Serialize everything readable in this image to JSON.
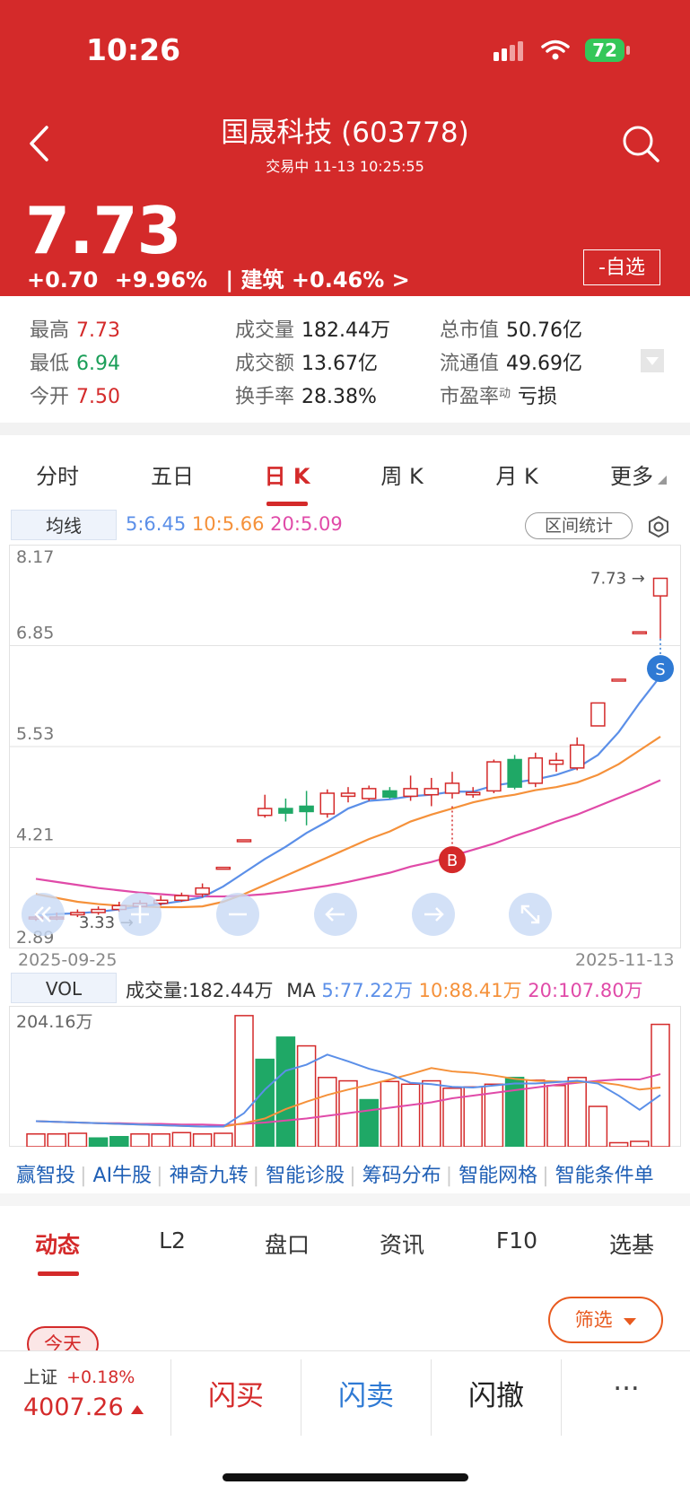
{
  "status_bar": {
    "time": "10:26",
    "battery": "72"
  },
  "header": {
    "title": "国晟科技 (603778)",
    "subtitle": "交易中  11-13 10:25:55",
    "price": "7.73",
    "change": "+0.70",
    "change_pct": "+9.96%",
    "sector": "| 建筑 +0.46% >",
    "fav_label": "-自选"
  },
  "stats": [
    {
      "label": "最高",
      "value": "7.73",
      "color": "red"
    },
    {
      "label": "最低",
      "value": "6.94",
      "color": "green"
    },
    {
      "label": "今开",
      "value": "7.50",
      "color": "red"
    },
    {
      "label": "成交量",
      "value": "182.44万",
      "color": "dark"
    },
    {
      "label": "成交额",
      "value": "13.67亿",
      "color": "dark"
    },
    {
      "label": "换手率",
      "value": "28.38%",
      "color": "dark"
    },
    {
      "label": "总市值",
      "value": "50.76亿",
      "color": "dark"
    },
    {
      "label": "流通值",
      "value": "49.69亿",
      "color": "dark"
    },
    {
      "label": "市盈率",
      "sup": "动",
      "value": "亏损",
      "color": "dark"
    }
  ],
  "chart_tabs": [
    "分时",
    "五日",
    "日 K",
    "周 K",
    "月 K",
    "更多"
  ],
  "ma_header": {
    "label": "均线",
    "ma5": "5:6.45",
    "ma10": "10:5.66",
    "ma20": "20:5.09",
    "interval_btn": "区间统计"
  },
  "vol_header": {
    "label": "VOL",
    "volume": "成交量:182.44万",
    "ma_label": "MA",
    "ma5": "5:77.22万",
    "ma10": "10:88.41万",
    "ma20": "20:107.80万"
  },
  "colors": {
    "up": "#d42a2a",
    "down": "#1fa866",
    "ma5": "#5b8fe8",
    "ma10": "#f5913a",
    "ma20": "#e04aa8",
    "header": "#d42a2a"
  },
  "chart_data": [
    {
      "type": "candlestick",
      "y_ticks": [
        "8.17",
        "6.85",
        "5.53",
        "4.21",
        "2.89"
      ],
      "ylim": [
        2.89,
        8.17
      ],
      "x_start": "2025-09-25",
      "x_end": "2025-11-13",
      "annotations": {
        "high_label": "7.73",
        "low_label": "3.33",
        "buy_marker": "B",
        "sell_marker": "S"
      },
      "candles": [
        [
          3.3,
          3.3,
          3.25,
          3.36
        ],
        [
          3.3,
          3.3,
          3.26,
          3.36
        ],
        [
          3.33,
          3.36,
          3.3,
          3.4
        ],
        [
          3.36,
          3.4,
          3.33,
          3.44
        ],
        [
          3.4,
          3.45,
          3.37,
          3.5
        ],
        [
          3.44,
          3.48,
          3.4,
          3.52
        ],
        [
          3.48,
          3.52,
          3.45,
          3.58
        ],
        [
          3.52,
          3.58,
          3.5,
          3.62
        ],
        [
          3.6,
          3.68,
          3.56,
          3.74
        ],
        [
          3.95,
          3.95,
          3.95,
          3.95
        ],
        [
          4.31,
          4.31,
          4.31,
          4.31
        ],
        [
          4.63,
          4.72,
          4.6,
          4.9
        ],
        [
          4.72,
          4.66,
          4.55,
          4.85
        ],
        [
          4.75,
          4.68,
          4.5,
          4.95
        ],
        [
          4.65,
          4.92,
          4.6,
          4.97
        ],
        [
          4.88,
          4.92,
          4.8,
          5.0
        ],
        [
          4.85,
          4.98,
          4.82,
          5.02
        ],
        [
          4.95,
          4.87,
          4.85,
          5.0
        ],
        [
          4.88,
          4.98,
          4.82,
          5.15
        ],
        [
          4.9,
          4.98,
          4.75,
          5.12
        ],
        [
          4.92,
          5.05,
          4.85,
          5.2
        ],
        [
          4.9,
          4.93,
          4.86,
          5.0
        ],
        [
          4.95,
          5.33,
          4.92,
          5.36
        ],
        [
          5.36,
          5.0,
          4.97,
          5.42
        ],
        [
          5.05,
          5.38,
          5.0,
          5.45
        ],
        [
          5.3,
          5.35,
          5.2,
          5.45
        ],
        [
          5.25,
          5.55,
          5.22,
          5.65
        ],
        [
          5.8,
          6.1,
          5.8,
          6.1
        ],
        [
          6.41,
          6.41,
          6.41,
          6.41
        ],
        [
          7.03,
          7.03,
          7.03,
          7.03
        ],
        [
          7.5,
          7.73,
          6.94,
          7.73
        ]
      ],
      "ma5": [
        3.32,
        3.34,
        3.35,
        3.37,
        3.4,
        3.44,
        3.47,
        3.51,
        3.56,
        3.7,
        3.88,
        4.06,
        4.22,
        4.4,
        4.55,
        4.72,
        4.82,
        4.84,
        4.88,
        4.9,
        4.94,
        4.94,
        5.02,
        5.06,
        5.1,
        5.16,
        5.25,
        5.42,
        5.72,
        6.1,
        6.45
      ],
      "ma10": [
        3.6,
        3.55,
        3.5,
        3.47,
        3.45,
        3.44,
        3.43,
        3.43,
        3.44,
        3.5,
        3.6,
        3.72,
        3.84,
        3.96,
        4.08,
        4.2,
        4.32,
        4.42,
        4.55,
        4.64,
        4.72,
        4.8,
        4.86,
        4.9,
        4.96,
        5.0,
        5.06,
        5.16,
        5.3,
        5.48,
        5.66
      ],
      "ma20": [
        3.8,
        3.76,
        3.72,
        3.68,
        3.65,
        3.62,
        3.6,
        3.58,
        3.57,
        3.57,
        3.58,
        3.6,
        3.63,
        3.67,
        3.71,
        3.76,
        3.82,
        3.88,
        3.96,
        4.02,
        4.1,
        4.18,
        4.26,
        4.36,
        4.45,
        4.55,
        4.64,
        4.75,
        4.86,
        4.97,
        5.09
      ]
    },
    {
      "type": "bar",
      "title": "VOL",
      "y_top_label": "204.16万",
      "ylim": [
        0,
        204.16
      ],
      "values": [
        19,
        19,
        20,
        13,
        15,
        19,
        19,
        21,
        19,
        20,
        195,
        130,
        163,
        150,
        103,
        98,
        70,
        97,
        93,
        98,
        87,
        89,
        93,
        103,
        99,
        91,
        103,
        60,
        6,
        8,
        182
      ],
      "up": [
        1,
        1,
        1,
        0,
        0,
        1,
        1,
        1,
        1,
        1,
        1,
        0,
        0,
        1,
        1,
        1,
        0,
        1,
        1,
        1,
        1,
        1,
        1,
        0,
        1,
        1,
        1,
        1,
        1,
        1,
        1
      ],
      "ma5": [
        38,
        37,
        36,
        35,
        34,
        33,
        32,
        31,
        30,
        30,
        50,
        85,
        113,
        122,
        137,
        127,
        116,
        108,
        95,
        93,
        89,
        88,
        91,
        94,
        94,
        96,
        98,
        94,
        76,
        55,
        77
      ],
      "ma10": [
        38,
        37,
        36,
        35,
        34,
        33,
        32,
        31,
        30,
        30,
        35,
        42,
        56,
        67,
        77,
        85,
        92,
        100,
        108,
        117,
        112,
        110,
        106,
        101,
        98,
        97,
        96,
        96,
        92,
        85,
        88
      ],
      "ma20": [
        38,
        37,
        36,
        35,
        35,
        34,
        34,
        33,
        33,
        32,
        34,
        36,
        39,
        42,
        46,
        50,
        54,
        58,
        62,
        66,
        72,
        76,
        80,
        84,
        88,
        92,
        95,
        98,
        100,
        100,
        108
      ]
    }
  ],
  "tools": [
    "赢智投",
    "AI牛股",
    "神奇九转",
    "智能诊股",
    "筹码分布",
    "智能网格",
    "智能条件单"
  ],
  "bottom_tabs": [
    "动态",
    "L2",
    "盘口",
    "资讯",
    "F10",
    "选基"
  ],
  "filter_label": "筛选",
  "today_tag": "今天",
  "index": {
    "name": "上证",
    "change": "+0.18%",
    "value": "4007.26"
  },
  "actions": {
    "flash_buy": "闪买",
    "flash_sell": "闪卖",
    "flash_cancel": "闪撤",
    "more": "···"
  }
}
